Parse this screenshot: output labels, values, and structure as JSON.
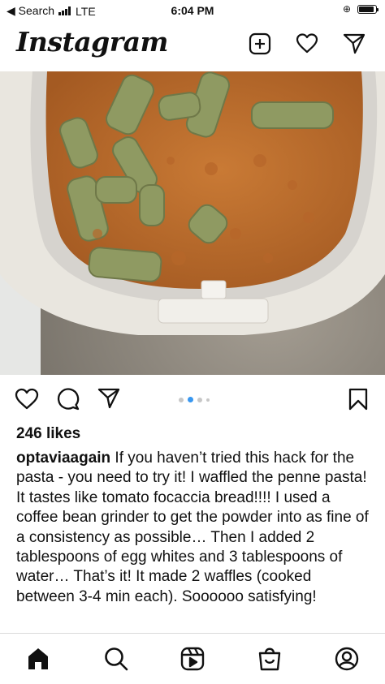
{
  "status_bar": {
    "back_label": "◀ Search",
    "network": "LTE",
    "time": "6:04 PM",
    "battery_level": 0.9
  },
  "header": {
    "logo_text": "Instagram",
    "icons": [
      "new-post-icon",
      "heart-icon",
      "direct-message-icon"
    ]
  },
  "post": {
    "image_description_icon": "photo",
    "carousel": {
      "count": 4,
      "active_index": 1
    },
    "likes": "246 likes",
    "username": "optaviaagain",
    "caption": " If you haven’t tried this hack for the pasta - you need to try it! I waffled the penne pasta! It tastes like tomato focaccia bread!!!! I used a coffee bean grinder to get the powder into as fine of a consistency as possible… Then I added 2 tablespoons of egg whites and 3 tablespoons of water… That’s it! It made 2 waffles (cooked between 3-4 min each). Soooooo satisfying!"
  },
  "tab_bar": {
    "icons": [
      "home-icon",
      "search-icon",
      "reels-icon",
      "shop-icon",
      "profile-icon"
    ]
  },
  "colors": {
    "accent_blue": "#3897f0",
    "text": "#111111"
  }
}
